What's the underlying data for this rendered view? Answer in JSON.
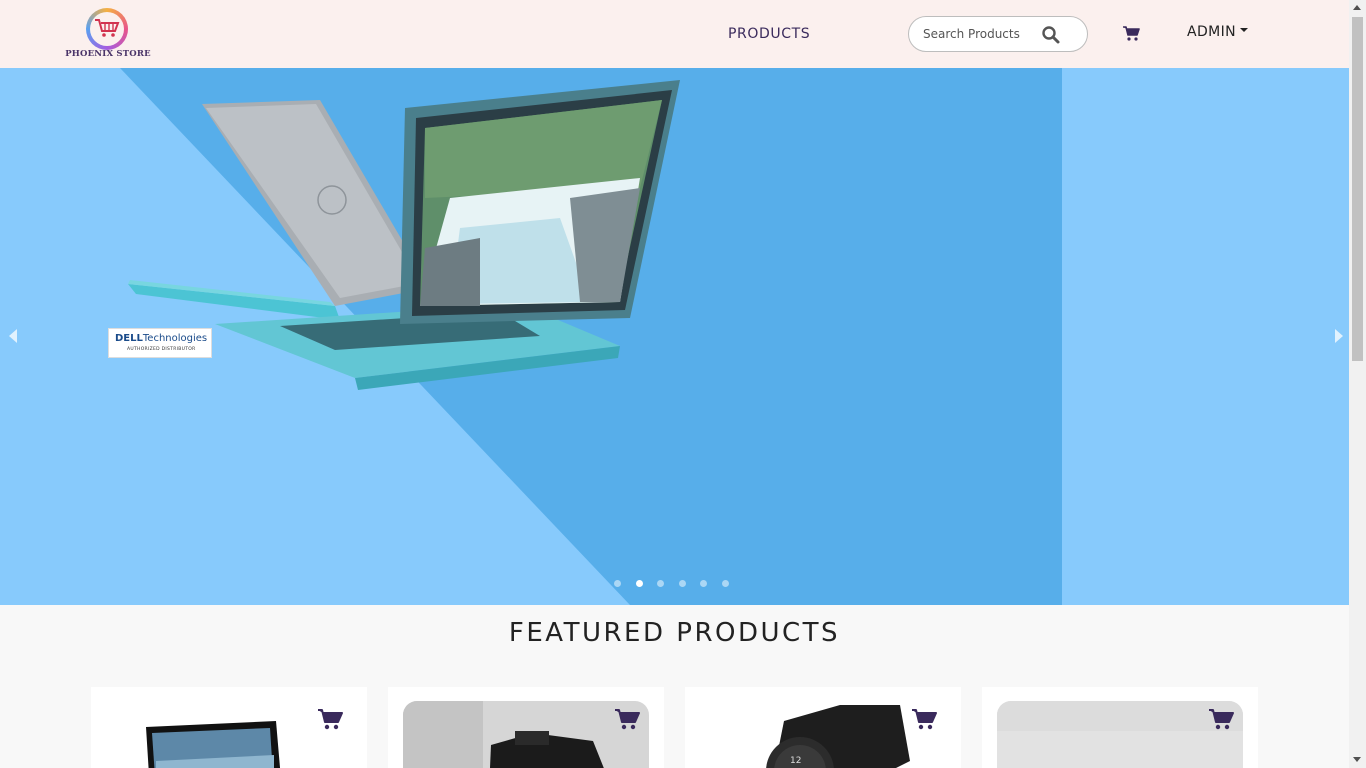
{
  "brand": {
    "name": "PHOENIX STORE"
  },
  "nav": {
    "products_label": "PRODUCTS",
    "search_placeholder": "Search Products",
    "admin_label": "ADMIN"
  },
  "carousel": {
    "badge_brand": "DELL",
    "badge_brand_suffix": "Technologies",
    "badge_sub": "AUTHORIZED DISTRIBUTOR",
    "slide_count": 6,
    "active_slide": 2
  },
  "featured": {
    "title": "FEATURED PRODUCTS",
    "cards": [
      {
        "product": "laptop"
      },
      {
        "product": "camera"
      },
      {
        "product": "smartwatch"
      },
      {
        "product": "product"
      }
    ]
  },
  "icons": {
    "search": "search-icon",
    "cart": "cart-icon",
    "prev": "chevron-left-icon",
    "next": "chevron-right-icon"
  },
  "colors": {
    "navbar_bg": "#fbf0ee",
    "accent": "#3a2a5c",
    "slide_bg": "#57aeea",
    "slide_light": "#87cafc"
  }
}
